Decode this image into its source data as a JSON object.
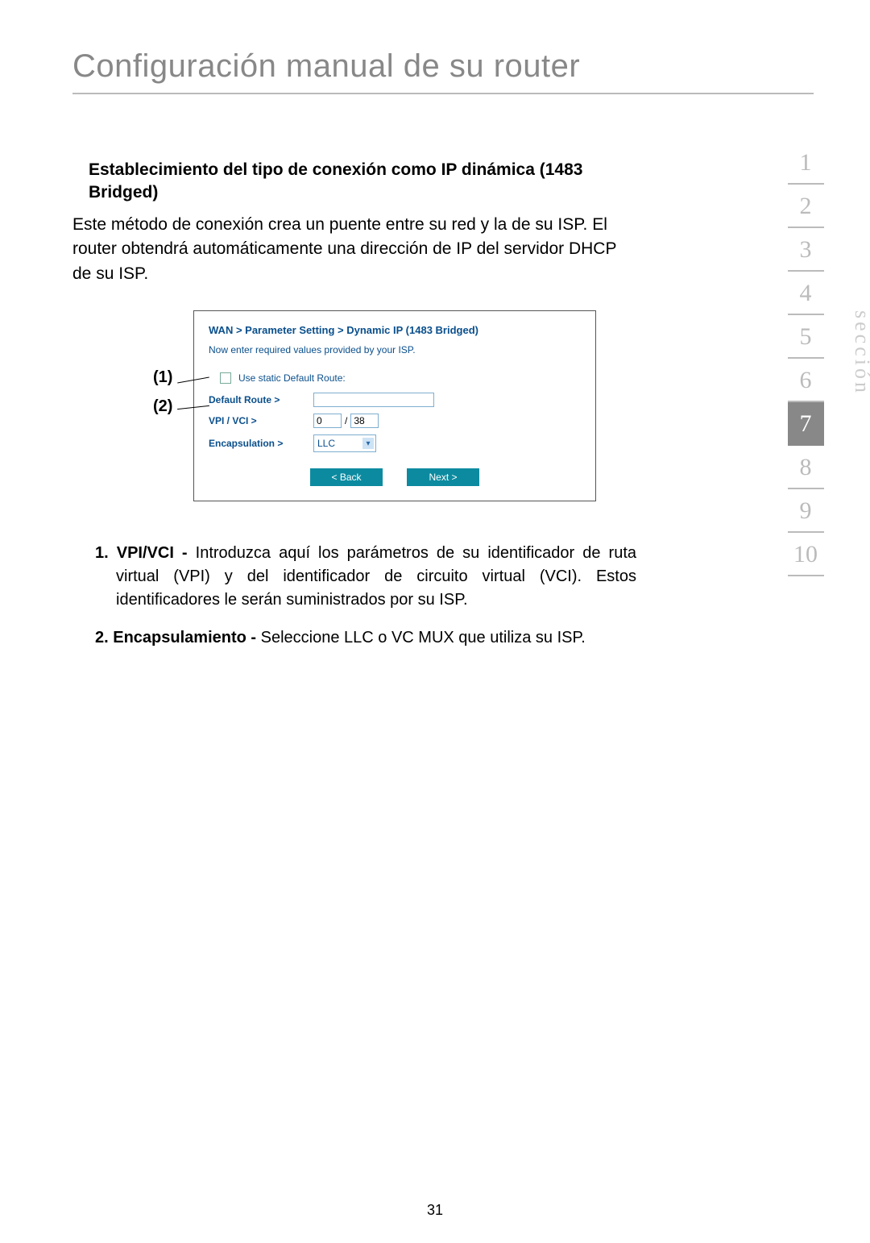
{
  "title": "Configuración manual de su router",
  "section_heading": "Establecimiento del tipo de conexión como IP dinámica (1483 Bridged)",
  "intro": "Este método de conexión crea un puente entre su red y la de su ISP. El router obtendrá automáticamente una dirección de IP del servidor DHCP de su ISP.",
  "callout1": "(1)",
  "callout2": "(2)",
  "fig": {
    "breadcrumb": "WAN > Parameter Setting > Dynamic IP (1483 Bridged)",
    "hint": "Now enter required values provided by your ISP.",
    "use_static_label": "Use static Default Route:",
    "default_route_label": "Default Route >",
    "default_route_value": "",
    "vpi_vci_label": "VPI / VCI >",
    "vpi_value": "0",
    "vci_value": "38",
    "encap_label": "Encapsulation >",
    "encap_value": "LLC",
    "back_btn": "< Back",
    "next_btn": "Next >"
  },
  "list": [
    {
      "num": "1.",
      "term": "VPI/VCI -",
      "body": " Introduzca aquí los parámetros de su identificador de ruta virtual (VPI) y del identificador de circuito virtual (VCI). Estos identificadores le serán suministrados por su ISP."
    },
    {
      "num": "2.",
      "term": "Encapsulamiento -",
      "body": " Seleccione LLC o VC MUX que utiliza su ISP."
    }
  ],
  "nav": {
    "label": "sección",
    "items": [
      "1",
      "2",
      "3",
      "4",
      "5",
      "6",
      "7",
      "8",
      "9",
      "10"
    ],
    "active": "7"
  },
  "page_number": "31"
}
